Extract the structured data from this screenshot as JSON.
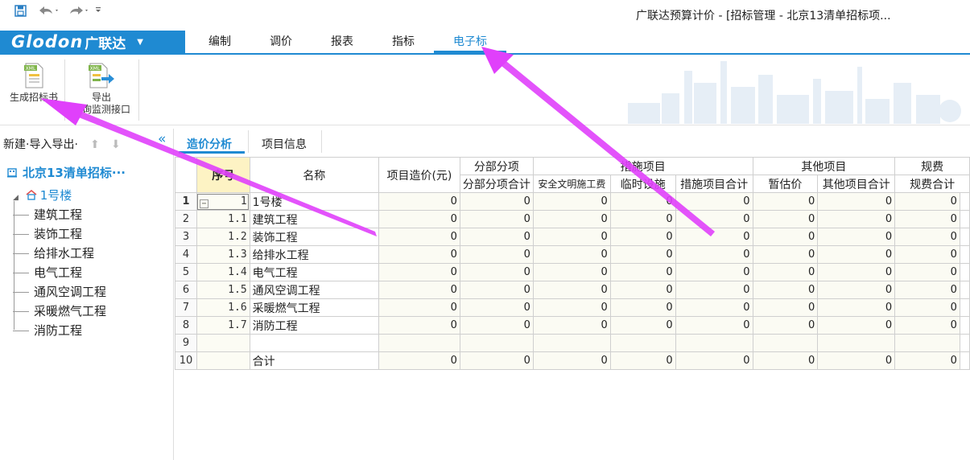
{
  "window": {
    "title": "广联达预算计价 - [招标管理 - 北京13清单招标项..."
  },
  "brand": {
    "logo_text": "Glodon",
    "logo_cn": "广联达"
  },
  "menu": {
    "items": [
      "编制",
      "调价",
      "报表",
      "指标",
      "电子标"
    ],
    "active_index": 4
  },
  "ribbon": {
    "generate_label": "生成招标书",
    "export_label_1": "导出",
    "export_label_2": "咨询监测接口",
    "xml_badge": "XML"
  },
  "leftpanel": {
    "new_label": "新建·",
    "import_export_label": "导入导出·",
    "project_name": "北京13清单招标···",
    "building": "1号楼",
    "children": [
      "建筑工程",
      "装饰工程",
      "给排水工程",
      "电气工程",
      "通风空调工程",
      "采暖燃气工程",
      "消防工程"
    ]
  },
  "tabs": [
    "造价分析",
    "项目信息"
  ],
  "grid": {
    "headers": {
      "seq": "序号",
      "name": "名称",
      "cost": "项目造价(元)",
      "g1": "分部分项",
      "g1c1": "分部分项合计",
      "g2": "措施项目",
      "g2c1": "安全文明施工费",
      "g2c2": "临时设施",
      "g2c3": "措施项目合计",
      "g3": "其他项目",
      "g3c1": "暂估价",
      "g3c2": "其他项目合计",
      "g4": "规费",
      "g4c1": "规费合计"
    },
    "rows": [
      {
        "rn": "1",
        "seq": "1",
        "name": "1号楼",
        "vals": [
          "0",
          "0",
          "0",
          "0",
          "0",
          "0",
          "0",
          "0"
        ]
      },
      {
        "rn": "2",
        "seq": "1.1",
        "name": "建筑工程",
        "vals": [
          "0",
          "0",
          "0",
          "0",
          "0",
          "0",
          "0",
          "0"
        ]
      },
      {
        "rn": "3",
        "seq": "1.2",
        "name": "装饰工程",
        "vals": [
          "0",
          "0",
          "0",
          "0",
          "0",
          "0",
          "0",
          "0"
        ]
      },
      {
        "rn": "4",
        "seq": "1.3",
        "name": "给排水工程",
        "vals": [
          "0",
          "0",
          "0",
          "0",
          "0",
          "0",
          "0",
          "0"
        ]
      },
      {
        "rn": "5",
        "seq": "1.4",
        "name": "电气工程",
        "vals": [
          "0",
          "0",
          "0",
          "0",
          "0",
          "0",
          "0",
          "0"
        ]
      },
      {
        "rn": "6",
        "seq": "1.5",
        "name": "通风空调工程",
        "vals": [
          "0",
          "0",
          "0",
          "0",
          "0",
          "0",
          "0",
          "0"
        ]
      },
      {
        "rn": "7",
        "seq": "1.6",
        "name": "采暖燃气工程",
        "vals": [
          "0",
          "0",
          "0",
          "0",
          "0",
          "0",
          "0",
          "0"
        ]
      },
      {
        "rn": "8",
        "seq": "1.7",
        "name": "消防工程",
        "vals": [
          "0",
          "0",
          "0",
          "0",
          "0",
          "0",
          "0",
          "0"
        ]
      },
      {
        "rn": "9",
        "seq": "",
        "name": "",
        "vals": [
          "",
          "",
          "",
          "",
          "",
          "",
          "",
          ""
        ]
      },
      {
        "rn": "10",
        "seq": "",
        "name": "合计",
        "vals": [
          "0",
          "0",
          "0",
          "0",
          "0",
          "0",
          "0",
          "0"
        ]
      }
    ]
  },
  "colors": {
    "accent": "#1f8ad2",
    "annotation": "#e040fb",
    "header_highlight": "#fdf3c4"
  },
  "icons": [
    "save-icon",
    "undo-icon",
    "redo-icon",
    "customize-icon",
    "xml-document-icon",
    "xml-export-icon",
    "project-icon",
    "building-icon",
    "collapse-icon",
    "up-arrow-icon",
    "down-arrow-icon"
  ]
}
